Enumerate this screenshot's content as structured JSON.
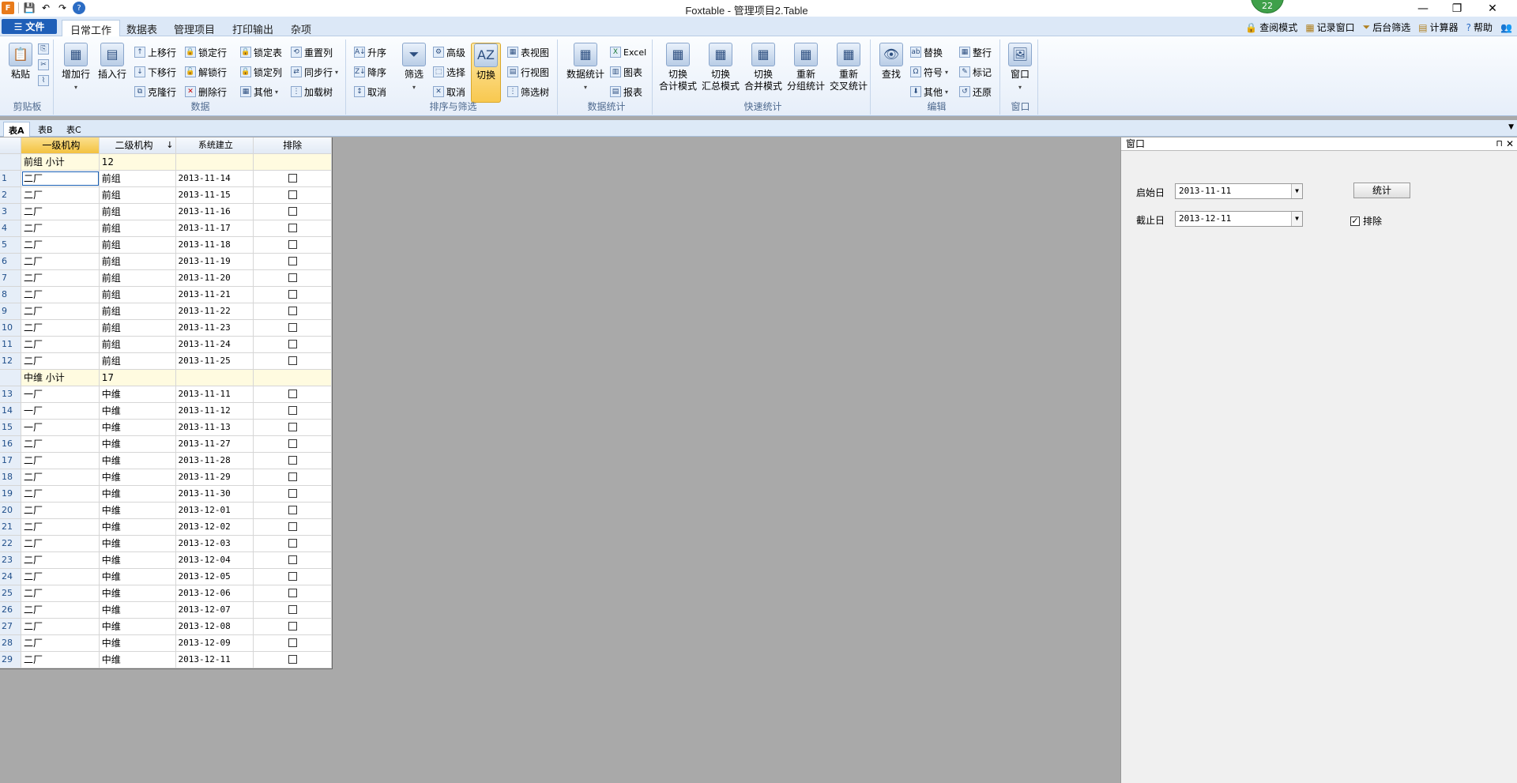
{
  "window": {
    "title": "Foxtable - 管理项目2.Table",
    "badge": "22",
    "minimize": "—",
    "restore": "❐",
    "close": "✕"
  },
  "qat": {
    "save": "💾",
    "undo": "↶",
    "redo": "↷",
    "help": "?"
  },
  "file_menu": "文件",
  "ribbon_tabs": [
    "日常工作",
    "数据表",
    "管理项目",
    "打印输出",
    "杂项"
  ],
  "top_links": [
    "查阅模式",
    "记录窗口",
    "后台筛选",
    "计算器",
    "帮助"
  ],
  "ribbon": {
    "clipboard": {
      "label": "剪贴板",
      "paste": "粘贴"
    },
    "data": {
      "label": "数据",
      "add_row": "增加行",
      "insert_row": "插入行",
      "move_up": "上移行",
      "move_down": "下移行",
      "clone_row": "克隆行",
      "lock_row": "锁定行",
      "unlock_row": "解锁行",
      "delete_row": "删除行",
      "lock_table": "锁定表",
      "lock_column": "锁定列",
      "other": "其他",
      "reset_column": "重置列",
      "sync_row": "同步行",
      "load_tree": "加载树"
    },
    "sort_filter": {
      "label": "排序与筛选",
      "asc": "升序",
      "desc": "降序",
      "cancel": "取消",
      "filter": "筛选",
      "advanced": "高级",
      "select": "选择",
      "cancel2": "取消",
      "toggle": "切换",
      "table_view": "表视图",
      "row_view": "行视图",
      "filter_tree": "筛选树"
    },
    "stats": {
      "label": "数据统计",
      "data_stats": "数据统计",
      "excel": "Excel",
      "chart": "图表",
      "report": "报表"
    },
    "quick_stats": {
      "label": "快速统计",
      "sum_mode": [
        "切换",
        "合计模式"
      ],
      "summary_mode": [
        "切换",
        "汇总模式"
      ],
      "merge_mode": [
        "切换",
        "合并模式"
      ],
      "group_stats": [
        "重新",
        "分组统计"
      ],
      "cross_stats": [
        "重新",
        "交叉统计"
      ]
    },
    "edit": {
      "label": "编辑",
      "find": "查找",
      "replace": "替换",
      "symbol": "符号",
      "other": "其他",
      "tidy": "整行",
      "mark": "标记",
      "restore": "还原"
    },
    "window": {
      "label": "窗口",
      "window": "窗口"
    }
  },
  "sheet_tabs": [
    "表A",
    "表B",
    "表C"
  ],
  "grid": {
    "columns": [
      "一级机构",
      "二级机构",
      "系统建立",
      "排除"
    ],
    "sort_indicator": "↓",
    "groups": [
      {
        "subtotal_label": "前组 小计",
        "subtotal_value": "12",
        "rows": [
          {
            "n": "1",
            "a": "二厂",
            "b": "前组",
            "date": "2013-11-14"
          },
          {
            "n": "2",
            "a": "二厂",
            "b": "前组",
            "date": "2013-11-15"
          },
          {
            "n": "3",
            "a": "二厂",
            "b": "前组",
            "date": "2013-11-16"
          },
          {
            "n": "4",
            "a": "二厂",
            "b": "前组",
            "date": "2013-11-17"
          },
          {
            "n": "5",
            "a": "二厂",
            "b": "前组",
            "date": "2013-11-18"
          },
          {
            "n": "6",
            "a": "二厂",
            "b": "前组",
            "date": "2013-11-19"
          },
          {
            "n": "7",
            "a": "二厂",
            "b": "前组",
            "date": "2013-11-20"
          },
          {
            "n": "8",
            "a": "二厂",
            "b": "前组",
            "date": "2013-11-21"
          },
          {
            "n": "9",
            "a": "二厂",
            "b": "前组",
            "date": "2013-11-22"
          },
          {
            "n": "10",
            "a": "二厂",
            "b": "前组",
            "date": "2013-11-23"
          },
          {
            "n": "11",
            "a": "二厂",
            "b": "前组",
            "date": "2013-11-24"
          },
          {
            "n": "12",
            "a": "二厂",
            "b": "前组",
            "date": "2013-11-25"
          }
        ]
      },
      {
        "subtotal_label": "中维 小计",
        "subtotal_value": "17",
        "rows": [
          {
            "n": "13",
            "a": "一厂",
            "b": "中维",
            "date": "2013-11-11"
          },
          {
            "n": "14",
            "a": "一厂",
            "b": "中维",
            "date": "2013-11-12"
          },
          {
            "n": "15",
            "a": "一厂",
            "b": "中维",
            "date": "2013-11-13"
          },
          {
            "n": "16",
            "a": "二厂",
            "b": "中维",
            "date": "2013-11-27"
          },
          {
            "n": "17",
            "a": "二厂",
            "b": "中维",
            "date": "2013-11-28"
          },
          {
            "n": "18",
            "a": "二厂",
            "b": "中维",
            "date": "2013-11-29"
          },
          {
            "n": "19",
            "a": "二厂",
            "b": "中维",
            "date": "2013-11-30"
          },
          {
            "n": "20",
            "a": "二厂",
            "b": "中维",
            "date": "2013-12-01"
          },
          {
            "n": "21",
            "a": "二厂",
            "b": "中维",
            "date": "2013-12-02"
          },
          {
            "n": "22",
            "a": "二厂",
            "b": "中维",
            "date": "2013-12-03"
          },
          {
            "n": "23",
            "a": "二厂",
            "b": "中维",
            "date": "2013-12-04"
          },
          {
            "n": "24",
            "a": "二厂",
            "b": "中维",
            "date": "2013-12-05"
          },
          {
            "n": "25",
            "a": "二厂",
            "b": "中维",
            "date": "2013-12-06"
          },
          {
            "n": "26",
            "a": "二厂",
            "b": "中维",
            "date": "2013-12-07"
          },
          {
            "n": "27",
            "a": "二厂",
            "b": "中维",
            "date": "2013-12-08"
          },
          {
            "n": "28",
            "a": "二厂",
            "b": "中维",
            "date": "2013-12-09"
          },
          {
            "n": "29",
            "a": "二厂",
            "b": "中维",
            "date": "2013-12-11"
          }
        ]
      }
    ]
  },
  "panel": {
    "title": "窗口",
    "pin": "⊓",
    "close": "✕",
    "start_label": "启始日",
    "start_value": "2013-11-11",
    "end_label": "截止日",
    "end_value": "2013-12-11",
    "stat_button": "统计",
    "exclude_label": "排除",
    "exclude_checked": true
  }
}
